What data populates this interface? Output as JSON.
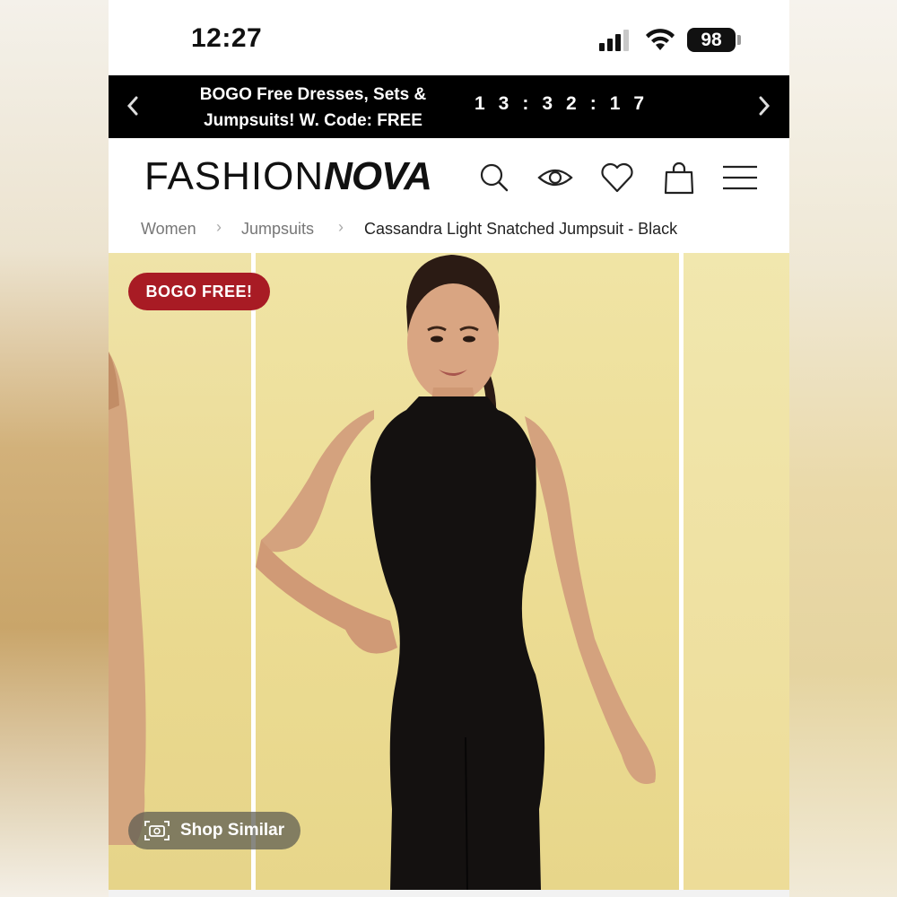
{
  "status_bar": {
    "time": "12:27",
    "battery": "98"
  },
  "promo": {
    "line1": "BOGO Free Dresses, Sets &",
    "line2": "Jumpsuits! W. Code: FREE",
    "countdown": "13:32:17",
    "prev_icon": "chevron-left-icon",
    "next_icon": "chevron-right-icon"
  },
  "header": {
    "logo_light": "FASHION",
    "logo_bold": "NOVA",
    "icons": [
      "search-icon",
      "eye-icon",
      "heart-icon",
      "shopping-bag-icon",
      "menu-icon"
    ]
  },
  "breadcrumb": {
    "items": [
      "Women",
      "Jumpsuits",
      "Cassandra Light Snatched Jumpsuit - Black"
    ],
    "separator": ">"
  },
  "gallery": {
    "badge": "BOGO FREE!",
    "shop_similar": "Shop Similar"
  },
  "colors": {
    "banner_bg": "#000000",
    "badge_red": "#a81b24",
    "backdrop_yellow": "#ecdc93",
    "garment_black": "#141110"
  }
}
